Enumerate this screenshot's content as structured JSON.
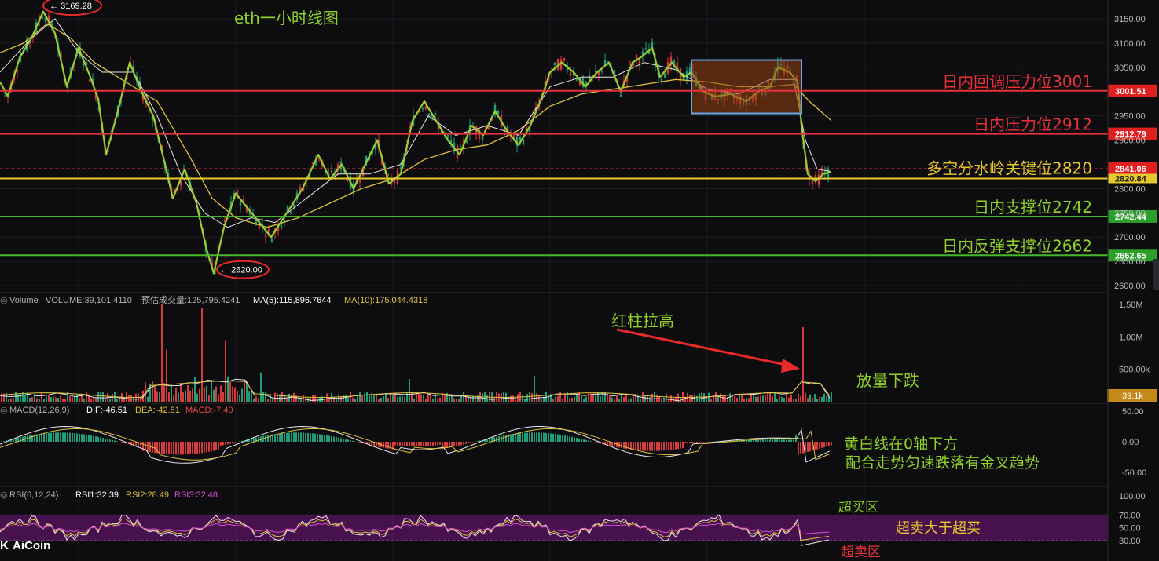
{
  "title": "eth一小时线图",
  "colors": {
    "bg": "#0d0d0f",
    "grid": "#1c1c20",
    "up": "#1e9e7a",
    "down": "#d63b3b",
    "price_line": "#9acd32",
    "ma_yellow": "#e0c23a",
    "ma_white": "#e8e8e8",
    "red_line": "#e8313a",
    "yellow_line": "#e6c92e",
    "green_line": "#46b82a",
    "axis_text": "#b9b9b9"
  },
  "chart_data": [
    {
      "type": "line",
      "name": "price-panel",
      "y_ticks": [
        3150,
        3100,
        3050,
        2950,
        2900,
        2800,
        2750,
        2700,
        2650,
        2600
      ],
      "y_tick_labels": [
        "3150.00",
        "3100.00",
        "3050.00",
        "2950.00",
        "2900.00",
        "2800.00",
        "2750.00",
        "2700.00",
        "2650.00",
        "2600.00"
      ],
      "ylim": [
        2590,
        3180
      ],
      "xlim": [
        0,
        1060
      ],
      "price_path": [
        [
          0,
          3020
        ],
        [
          10,
          2990
        ],
        [
          25,
          3070
        ],
        [
          40,
          3110
        ],
        [
          55,
          3165
        ],
        [
          70,
          3120
        ],
        [
          85,
          3010
        ],
        [
          100,
          3090
        ],
        [
          115,
          3030
        ],
        [
          125,
          2985
        ],
        [
          135,
          2870
        ],
        [
          150,
          2960
        ],
        [
          165,
          3060
        ],
        [
          180,
          3000
        ],
        [
          195,
          2950
        ],
        [
          210,
          2850
        ],
        [
          220,
          2780
        ],
        [
          235,
          2840
        ],
        [
          250,
          2770
        ],
        [
          262,
          2680
        ],
        [
          272,
          2625
        ],
        [
          285,
          2720
        ],
        [
          300,
          2790
        ],
        [
          315,
          2760
        ],
        [
          330,
          2730
        ],
        [
          345,
          2700
        ],
        [
          365,
          2750
        ],
        [
          385,
          2800
        ],
        [
          405,
          2870
        ],
        [
          420,
          2820
        ],
        [
          435,
          2850
        ],
        [
          450,
          2800
        ],
        [
          465,
          2850
        ],
        [
          480,
          2900
        ],
        [
          495,
          2810
        ],
        [
          510,
          2830
        ],
        [
          525,
          2940
        ],
        [
          540,
          2980
        ],
        [
          555,
          2940
        ],
        [
          570,
          2900
        ],
        [
          585,
          2870
        ],
        [
          600,
          2930
        ],
        [
          615,
          2910
        ],
        [
          630,
          2960
        ],
        [
          645,
          2920
        ],
        [
          660,
          2890
        ],
        [
          675,
          2930
        ],
        [
          690,
          2990
        ],
        [
          700,
          3040
        ],
        [
          715,
          3060
        ],
        [
          730,
          3040
        ],
        [
          745,
          3010
        ],
        [
          760,
          3040
        ],
        [
          775,
          3060
        ],
        [
          790,
          3000
        ],
        [
          805,
          3060
        ],
        [
          815,
          3070
        ],
        [
          830,
          3090
        ],
        [
          840,
          3030
        ],
        [
          855,
          3060
        ],
        [
          870,
          3030
        ],
        [
          880,
          3040
        ],
        [
          895,
          3000
        ],
        [
          910,
          2990
        ],
        [
          930,
          2995
        ],
        [
          950,
          2980
        ],
        [
          965,
          3000
        ],
        [
          980,
          3010
        ],
        [
          990,
          3050
        ],
        [
          1005,
          3040
        ],
        [
          1015,
          3020
        ],
        [
          1020,
          2930
        ],
        [
          1028,
          2830
        ],
        [
          1038,
          2815
        ],
        [
          1048,
          2830
        ],
        [
          1058,
          2835
        ]
      ],
      "ma_yellow_path": [
        [
          0,
          3080
        ],
        [
          30,
          3100
        ],
        [
          60,
          3140
        ],
        [
          90,
          3110
        ],
        [
          120,
          3060
        ],
        [
          160,
          3020
        ],
        [
          200,
          2980
        ],
        [
          240,
          2870
        ],
        [
          270,
          2780
        ],
        [
          300,
          2740
        ],
        [
          340,
          2720
        ],
        [
          380,
          2740
        ],
        [
          420,
          2770
        ],
        [
          460,
          2800
        ],
        [
          500,
          2820
        ],
        [
          540,
          2860
        ],
        [
          580,
          2880
        ],
        [
          620,
          2890
        ],
        [
          660,
          2920
        ],
        [
          700,
          2970
        ],
        [
          740,
          2995
        ],
        [
          780,
          3005
        ],
        [
          820,
          3015
        ],
        [
          860,
          3025
        ],
        [
          900,
          3020
        ],
        [
          940,
          3010
        ],
        [
          980,
          3010
        ],
        [
          1010,
          3015
        ],
        [
          1030,
          2980
        ],
        [
          1058,
          2940
        ]
      ],
      "ma_white_path": [
        [
          0,
          3040
        ],
        [
          40,
          3110
        ],
        [
          70,
          3150
        ],
        [
          100,
          3080
        ],
        [
          130,
          3040
        ],
        [
          170,
          3040
        ],
        [
          200,
          2950
        ],
        [
          230,
          2830
        ],
        [
          260,
          2750
        ],
        [
          290,
          2720
        ],
        [
          320,
          2740
        ],
        [
          350,
          2730
        ],
        [
          390,
          2780
        ],
        [
          430,
          2830
        ],
        [
          470,
          2830
        ],
        [
          510,
          2850
        ],
        [
          545,
          2950
        ],
        [
          580,
          2910
        ],
        [
          620,
          2930
        ],
        [
          660,
          2910
        ],
        [
          700,
          3010
        ],
        [
          740,
          3030
        ],
        [
          780,
          3030
        ],
        [
          820,
          3060
        ],
        [
          860,
          3045
        ],
        [
          900,
          3005
        ],
        [
          940,
          2995
        ],
        [
          980,
          3025
        ],
        [
          1010,
          3025
        ],
        [
          1025,
          2900
        ],
        [
          1040,
          2840
        ],
        [
          1058,
          2835
        ]
      ],
      "price_lines": [
        {
          "value": 3001.51,
          "label": "3001.51",
          "caption": "日内回调压力位3001",
          "kind": "red"
        },
        {
          "value": 2912.79,
          "label": "2912.79",
          "caption": "日内压力位2912",
          "kind": "red"
        },
        {
          "value": 2841.06,
          "label": "2841.06",
          "caption": "",
          "kind": "current"
        },
        {
          "value": 2820.84,
          "label": "2820.84",
          "caption": "多空分水岭关键位2820",
          "kind": "yellow"
        },
        {
          "value": 2742.44,
          "label": "2742.44",
          "caption": "日内支撑位2742",
          "kind": "green"
        },
        {
          "value": 2662.65,
          "label": "2662.65",
          "caption": "日内反弹支撑位2662",
          "kind": "green"
        }
      ],
      "high_marker": {
        "x": 55,
        "value": 3169.28,
        "label": "← 3169.28"
      },
      "low_marker": {
        "x": 272,
        "value": 2620.0,
        "label": "← 2620.00"
      },
      "box": {
        "x0": 880,
        "x1": 1020,
        "y_top": 3065,
        "y_bottom": 2955
      }
    },
    {
      "type": "bar",
      "name": "volume-panel",
      "header": {
        "name": "Volume",
        "volume": "VOLUME:39,101.4110",
        "forecast": "预估成交量:125,795.4241",
        "ma5": "MA(5):115,896.7644",
        "ma10": "MA(10):175,044.4318"
      },
      "y_ticks": [
        1500000,
        1000000,
        500000
      ],
      "y_tick_labels": [
        "1.50M",
        "1.00M",
        "500.00k"
      ],
      "ylim": [
        0,
        1600000
      ],
      "current_label": "39.1k",
      "spikes": [
        [
          205,
          1500000,
          "down"
        ],
        [
          255,
          1450000,
          "down"
        ],
        [
          210,
          800000,
          "down"
        ],
        [
          285,
          950000,
          "down"
        ],
        [
          1021,
          1150000,
          "down"
        ],
        [
          330,
          450000,
          "up"
        ],
        [
          520,
          350000,
          "up"
        ],
        [
          680,
          400000,
          "up"
        ]
      ],
      "annotation_top": "红柱拉高",
      "annotation_side": "放量下跌"
    },
    {
      "type": "bar",
      "name": "macd-panel",
      "header": {
        "name": "MACD(12,26,9)",
        "dif": "DIF:-46.51",
        "dea": "DEA:-42.81",
        "macd": "MACD:-7.40"
      },
      "y_ticks": [
        50,
        0,
        -50
      ],
      "y_tick_labels": [
        "50.00",
        "0.00",
        "-50.00"
      ],
      "ylim": [
        -65,
        65
      ],
      "annotation_lines": [
        "黄白线在0轴下方",
        "配合走势匀速跌落有金叉趋势"
      ]
    },
    {
      "type": "line",
      "name": "rsi-panel",
      "header": {
        "name": "RSI(6,12,24)",
        "rsi1": "RSI1:32.39",
        "rsi2": "RSI2:28.49",
        "rsi3": "RSI3:32.48"
      },
      "y_ticks": [
        100,
        70,
        50,
        30
      ],
      "y_tick_labels": [
        "100.00",
        "70.00",
        "50.00",
        "30.00"
      ],
      "ylim": [
        0,
        110
      ],
      "overbought": "超买区",
      "oversold": "超卖区",
      "band_label": "超卖大于超买"
    }
  ],
  "logo": "AiCoin"
}
